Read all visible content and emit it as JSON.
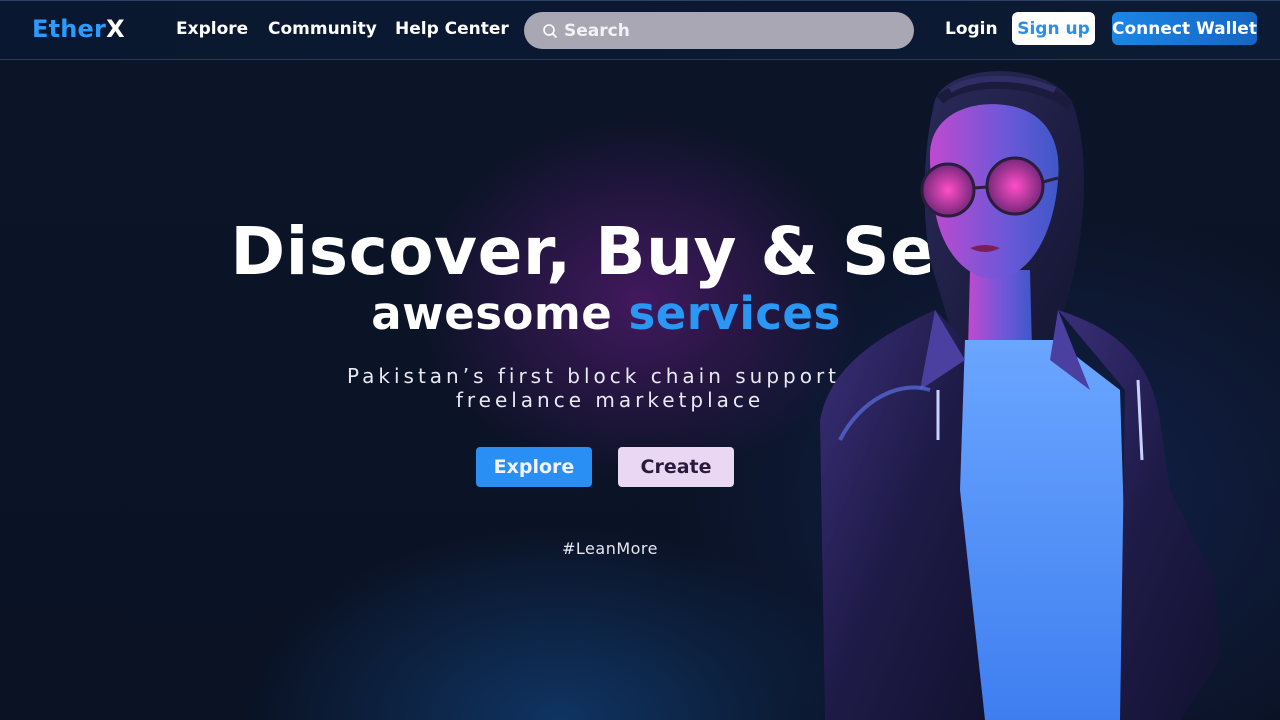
{
  "header": {
    "logo_part1": "Ether",
    "logo_part2": "X",
    "nav": [
      "Explore",
      "Community",
      "Help Center"
    ],
    "search_placeholder": "Search",
    "login_label": "Login",
    "signup_label": "Sign up",
    "wallet_label": "Connect Wallet"
  },
  "hero": {
    "title": "Discover, Buy & Sell",
    "subtitle_plain": "awesome ",
    "subtitle_highlight": "services",
    "tagline_line1": "Pakistan’s first block chain supported",
    "tagline_line2": "freelance marketplace",
    "explore_label": "Explore",
    "create_label": "Create",
    "learn_more": "#LeanMore"
  },
  "colors": {
    "accent": "#2a97f5",
    "background": "#0b1326",
    "create_button": "#ead7f4",
    "search_bg": "#a9a7b4"
  },
  "icons": {
    "search": "search-icon"
  }
}
